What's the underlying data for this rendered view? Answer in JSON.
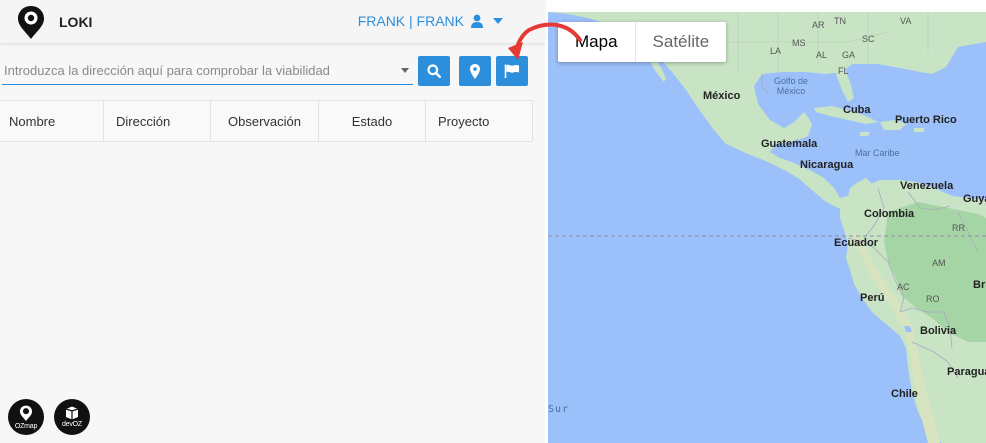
{
  "header": {
    "app_title": "LOKI",
    "user_name": "FRANK | FRANK",
    "icons": {
      "logo": "map-pin-logo",
      "user": "user-icon",
      "dropdown": "chevron-down-icon"
    }
  },
  "search": {
    "placeholder": "Introduzca la dirección aquí para comprobar la viabilidad",
    "value": "",
    "buttons": {
      "search": "search-icon",
      "location": "map-marker-icon",
      "flag": "flag-icon"
    }
  },
  "table": {
    "columns": [
      "Nombre",
      "Dirección",
      "Observación",
      "Estado",
      "Proyecto"
    ],
    "rows": []
  },
  "footer_badges": [
    {
      "label": "OZmap",
      "icon": "map-pin-logo"
    },
    {
      "label": "devOZ",
      "icon": "box-icon"
    }
  ],
  "map": {
    "map_type_options": [
      {
        "label": "Mapa",
        "active": true
      },
      {
        "label": "Satélite",
        "active": false
      }
    ],
    "labels": {
      "mexico": "México",
      "golfo": "Golfo de\nMéxico",
      "cuba": "Cuba",
      "puerto_rico": "Puerto Rico",
      "guatemala": "Guatemala",
      "mar_caribe": "Mar Caribe",
      "nicaragua": "Nicaragua",
      "venezuela": "Venezuela",
      "colombia": "Colombia",
      "ecuador": "Ecuador",
      "peru": "Perú",
      "bolivia": "Bolivia",
      "chile": "Chile",
      "paragua": "Paragua",
      "sur": "Sur",
      "guyana": "Guyar",
      "brasil": "Br",
      "am": "AM",
      "ac": "AC",
      "ro": "RO",
      "rr": "RR",
      "ar": "AR",
      "ms": "MS",
      "al": "AL",
      "ga": "GA",
      "sc": "SC",
      "fl": "FL",
      "la": "LA",
      "tn": "TN",
      "va": "VA"
    },
    "colors": {
      "water": "#9cc0f9",
      "land": "#c8e6c9",
      "forest": "#a5d6a7",
      "equator": "#8e8ea8"
    }
  },
  "colors": {
    "accent": "#2d8fdc",
    "panel_bg": "#f7f7f7"
  }
}
